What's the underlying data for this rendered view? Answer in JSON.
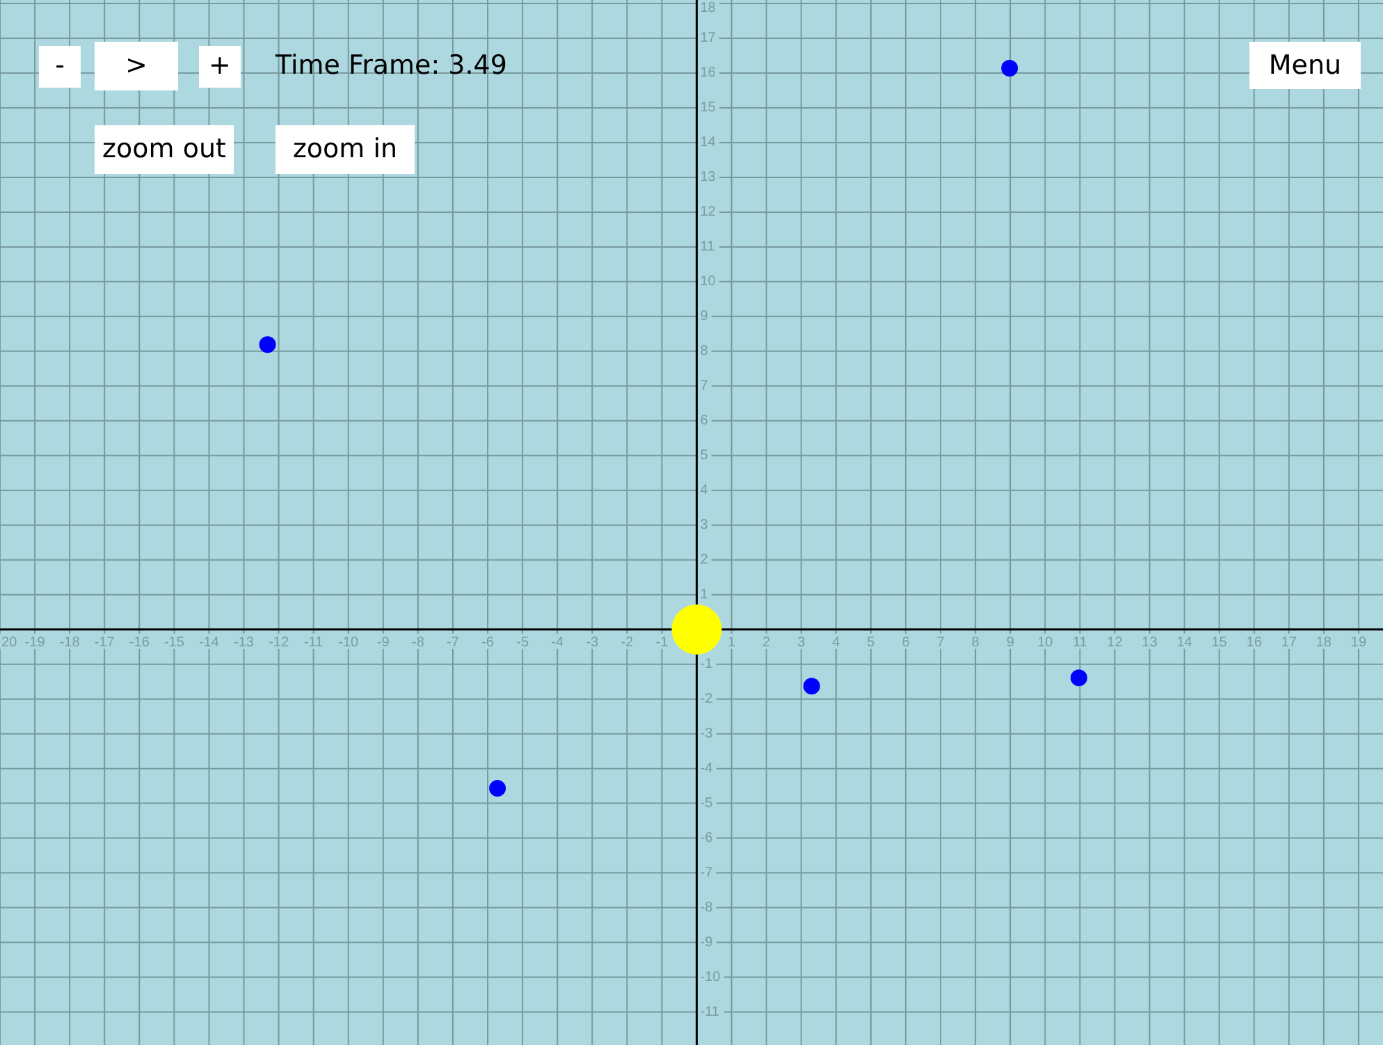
{
  "controls": {
    "buttons": [
      {
        "kind": "decrease",
        "label": "-"
      },
      {
        "kind": "play",
        "label": ">"
      },
      {
        "kind": "increase",
        "label": "+"
      }
    ],
    "time_frame": "Time Frame: 3.49",
    "zoom_buttons": [
      {
        "kind": "zoom_out",
        "label": "zoom out"
      },
      {
        "kind": "zoom_in",
        "label": "zoom in"
      }
    ]
  },
  "menu_button": {
    "label": "Menu"
  },
  "plot": {
    "chart_data": {
      "type": "scatter",
      "grid": true,
      "x": [
        8.98,
        -12.32,
        3.3,
        10.97,
        -5.72,
        0
      ],
      "series": [
        {
          "color": "#0000ff",
          "values": [
            16.14,
            8.19,
            -1.63,
            -1.39,
            -4.57,
            null
          ]
        },
        {
          "color": "#ffff00",
          "values": [
            null,
            null,
            null,
            null,
            null,
            0
          ]
        }
      ],
      "xlim": [
        -20,
        19.7
      ],
      "ylim": [
        -11.95,
        18.1
      ],
      "xticks": [
        {
          "value": -20,
          "label": "20"
        },
        -19,
        -18,
        -17,
        -16,
        -15,
        -14,
        -13,
        -12,
        -11,
        -10,
        -9,
        -8,
        -7,
        -6,
        -5,
        -4,
        -3,
        -2,
        -1,
        1,
        2,
        3,
        4,
        5,
        6,
        7,
        8,
        9,
        10,
        11,
        12,
        13,
        14,
        15,
        16,
        17,
        18,
        19
      ],
      "yticks": [
        -11,
        -10,
        -9,
        -8,
        -7,
        -6,
        -5,
        -4,
        -3,
        -2,
        -1,
        1,
        2,
        3,
        4,
        5,
        6,
        7,
        8,
        9,
        10,
        11,
        12,
        13,
        14,
        15,
        16,
        17,
        18
      ]
    }
  }
}
